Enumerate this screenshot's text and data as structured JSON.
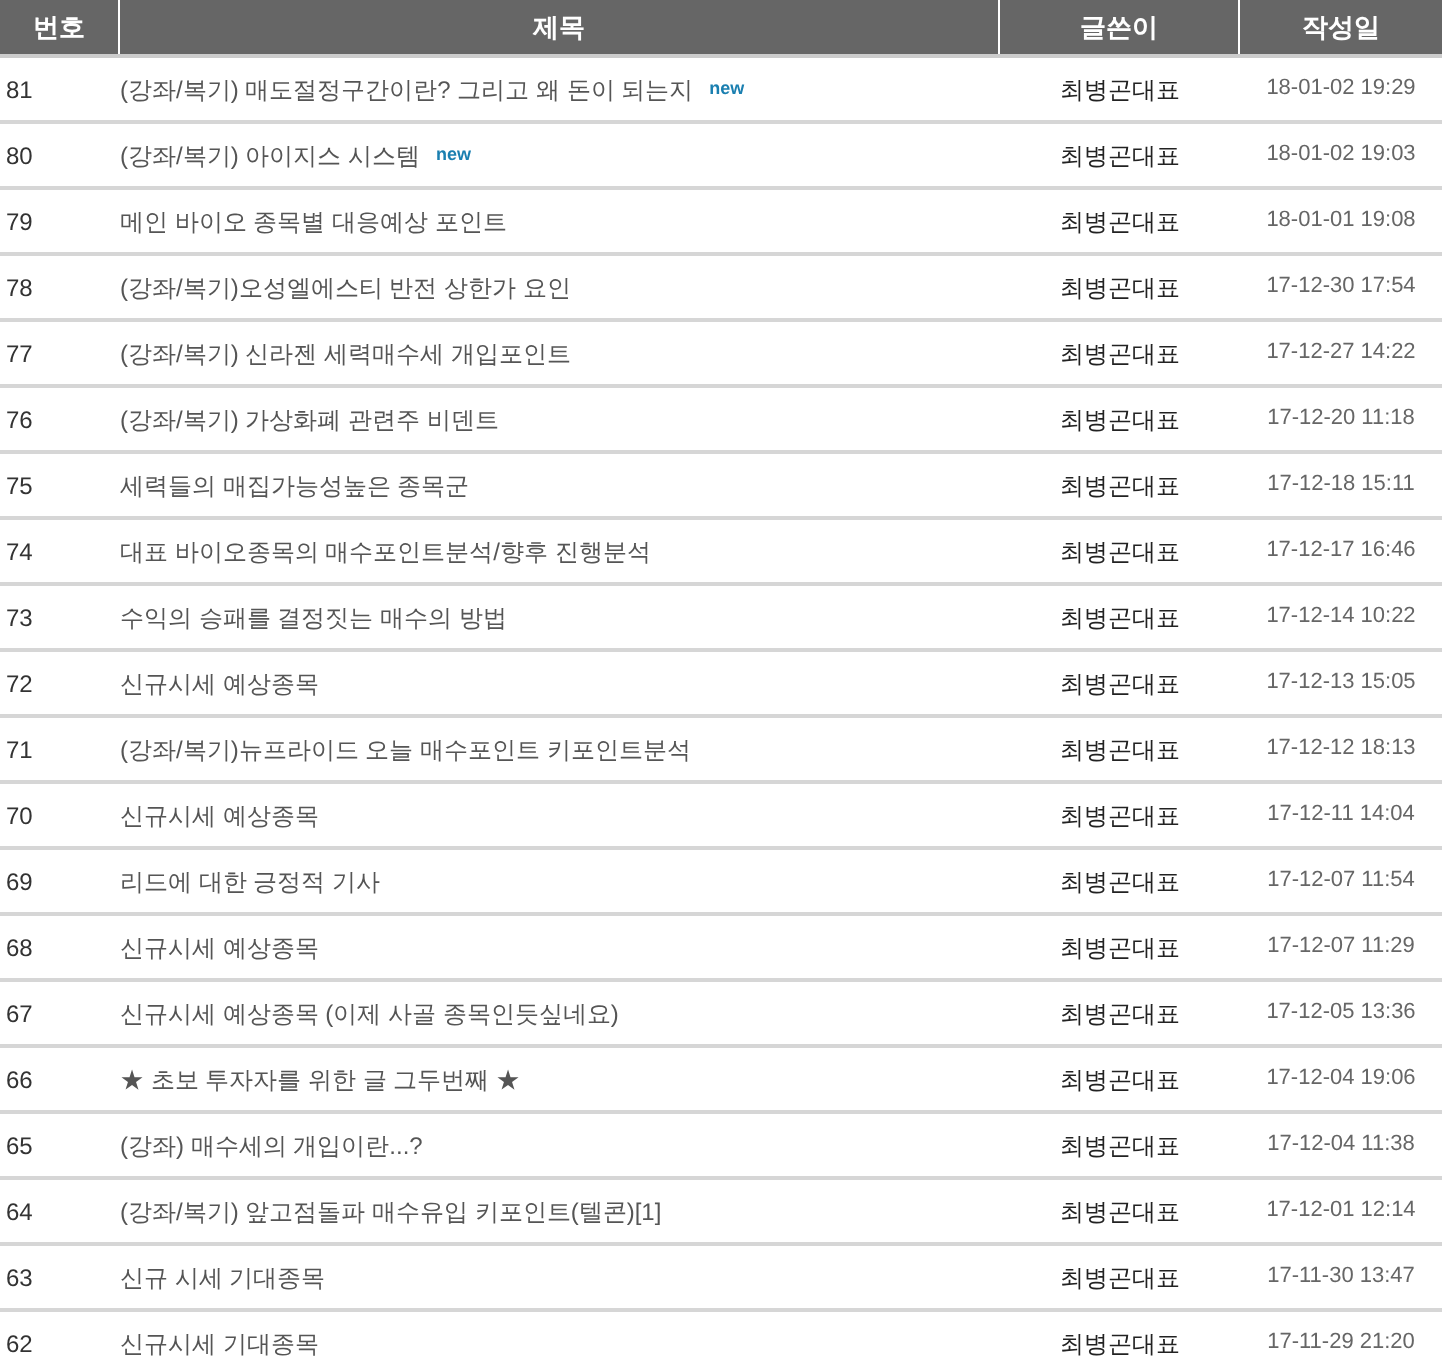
{
  "columns": [
    "번호",
    "제목",
    "글쓴이",
    "작성일"
  ],
  "rows": [
    {
      "number": "81",
      "title": "(강좌/복기) 매도절정구간이란? 그리고 왜 돈이 되는지",
      "badge": "new",
      "author": "최병곤대표",
      "date": "18-01-02 19:29"
    },
    {
      "number": "80",
      "title": "(강좌/복기) 아이지스 시스템",
      "badge": "new",
      "author": "최병곤대표",
      "date": "18-01-02 19:03"
    },
    {
      "number": "79",
      "title": "메인 바이오 종목별 대응예상 포인트",
      "author": "최병곤대표",
      "date": "18-01-01 19:08"
    },
    {
      "number": "78",
      "title": "(강좌/복기)오성엘에스티 반전 상한가 요인",
      "author": "최병곤대표",
      "date": "17-12-30 17:54"
    },
    {
      "number": "77",
      "title": "(강좌/복기) 신라젠 세력매수세 개입포인트",
      "author": "최병곤대표",
      "date": "17-12-27 14:22"
    },
    {
      "number": "76",
      "title": "(강좌/복기) 가상화폐 관련주 비덴트",
      "author": "최병곤대표",
      "date": "17-12-20 11:18"
    },
    {
      "number": "75",
      "title": "세력들의 매집가능성높은 종목군",
      "author": "최병곤대표",
      "date": "17-12-18 15:11"
    },
    {
      "number": "74",
      "title": "대표 바이오종목의 매수포인트분석/향후 진행분석",
      "author": "최병곤대표",
      "date": "17-12-17 16:46"
    },
    {
      "number": "73",
      "title": "수익의 승패를 결정짓는 매수의 방법",
      "author": "최병곤대표",
      "date": "17-12-14 10:22"
    },
    {
      "number": "72",
      "title": "신규시세 예상종목",
      "author": "최병곤대표",
      "date": "17-12-13 15:05"
    },
    {
      "number": "71",
      "title": "(강좌/복기)뉴프라이드 오늘 매수포인트 키포인트분석",
      "author": "최병곤대표",
      "date": "17-12-12 18:13"
    },
    {
      "number": "70",
      "title": "신규시세 예상종목",
      "author": "최병곤대표",
      "date": "17-12-11 14:04"
    },
    {
      "number": "69",
      "title": "리드에 대한 긍정적 기사",
      "author": "최병곤대표",
      "date": "17-12-07 11:54"
    },
    {
      "number": "68",
      "title": "신규시세 예상종목",
      "author": "최병곤대표",
      "date": "17-12-07 11:29"
    },
    {
      "number": "67",
      "title": "신규시세 예상종목 (이제 사골 종목인듯싶네요)",
      "author": "최병곤대표",
      "date": "17-12-05 13:36"
    },
    {
      "number": "66",
      "title": "★ 초보 투자자를 위한 글 그두번째 ★",
      "author": "최병곤대표",
      "date": "17-12-04 19:06"
    },
    {
      "number": "65",
      "title": "(강좌) 매수세의 개입이란...?",
      "author": "최병곤대표",
      "date": "17-12-04 11:38"
    },
    {
      "number": "64",
      "title": "(강좌/복기) 앞고점돌파 매수유입 키포인트(텔콘)[1]",
      "author": "최병곤대표",
      "date": "17-12-01 12:14"
    },
    {
      "number": "63",
      "title": "신규 시세 기대종목",
      "author": "최병곤대표",
      "date": "17-11-30 13:47"
    },
    {
      "number": "62",
      "title": "신규시세 기대종목",
      "author": "최병곤대표",
      "date": "17-11-29 21:20"
    }
  ]
}
